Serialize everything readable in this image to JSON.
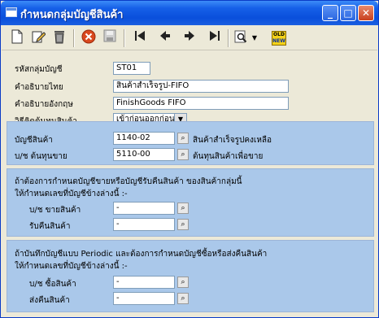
{
  "window": {
    "title": "กำหนดกลุ่มบัญชีสินค้า",
    "min_glyph": "_",
    "max_glyph": "□",
    "close_glyph": "✕"
  },
  "toolbar": {
    "icons": [
      "new-icon",
      "edit-icon",
      "delete-icon",
      "cancel-icon",
      "save-icon",
      "first-icon",
      "prev-icon",
      "next-icon",
      "last-icon",
      "search-icon",
      "dropdown-arrow-icon",
      "old-new-icon"
    ],
    "old_label": "OLD",
    "new_label": "NEW"
  },
  "form": {
    "group_code_label": "รหัสกลุ่มบัญชี",
    "group_code_value": "ST01",
    "desc_thai_label": "คำอธิบายไทย",
    "desc_thai_value": "สินค้าสำเร็จรูป-FIFO",
    "desc_eng_label": "คำอธิบายอังกฤษ",
    "desc_eng_value": "FinishGoods FIFO",
    "cost_method_label": "วิธีคิดต้นทุนสินค้า",
    "cost_method_value": "เข้าก่อนออกก่อน"
  },
  "accounts": {
    "inventory_label": "บัญชีสินค้า",
    "inventory_code": "1140-02",
    "inventory_desc": "สินค้าสำเร็จรูปคงเหลือ",
    "cogs_label": "บ/ช ต้นทุนขาย",
    "cogs_code": "5110-00",
    "cogs_desc": "ต้นทุนสินค้าเพื่อขาย"
  },
  "returns_section": {
    "line1": "ถ้าต้องการกำหนดบัญชีขายหรือบัญชีรับคืนสินค้า ของสินค้ากลุ่มนี้",
    "line2": "ให้กำหนดเลขที่บัญชีข้างล่างนี้ :-",
    "sales_label": "บ/ช ขายสินค้า",
    "sales_value": "-",
    "return_label": "รับคืนสินค้า",
    "return_value": "-"
  },
  "periodic_section": {
    "line1": "ถ้าบันทึกบัญชีแบบ Periodic และต้องการกำหนดบัญชีซื้อหรือส่งคืนสินค้า",
    "line2": "ให้กำหนดเลขที่บัญชีข้างล่างนี้ :-",
    "purchase_label": "บ/ช ซื้อสินค้า",
    "purchase_value": "-",
    "purchase_return_label": "ส่งคืนสินค้า",
    "purchase_return_value": "-"
  },
  "colors": {
    "titlebar": "#0a4fdc",
    "panel_blue": "#aac8ea",
    "window_bg": "#ece9d8"
  }
}
